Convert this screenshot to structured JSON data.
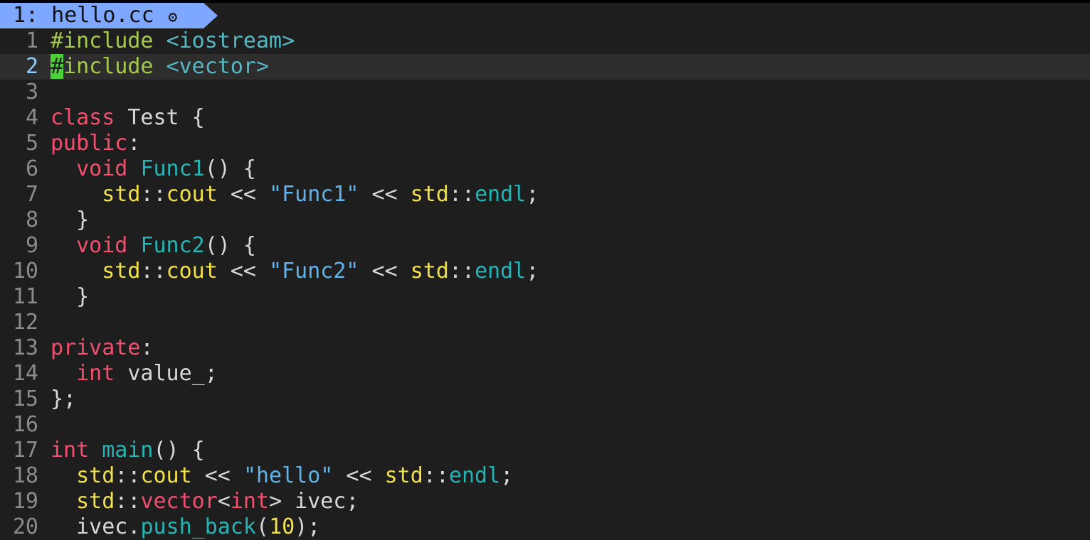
{
  "tab": {
    "label": "1: hello.cc",
    "icon": "cplusplus-icon"
  },
  "current_line": 2,
  "lines": [
    {
      "num": "1",
      "tokens": [
        {
          "c": "pp",
          "t": "#include"
        },
        {
          "c": "pl",
          "t": " "
        },
        {
          "c": "inc",
          "t": "<iostream>"
        }
      ]
    },
    {
      "num": "2",
      "tokens": [
        {
          "c": "cursor",
          "t": "#"
        },
        {
          "c": "pp",
          "t": "include"
        },
        {
          "c": "pl",
          "t": " "
        },
        {
          "c": "inc",
          "t": "<vector>"
        }
      ]
    },
    {
      "num": "3",
      "tokens": []
    },
    {
      "num": "4",
      "tokens": [
        {
          "c": "kw",
          "t": "class"
        },
        {
          "c": "pl",
          "t": " Test {"
        }
      ]
    },
    {
      "num": "5",
      "tokens": [
        {
          "c": "kw",
          "t": "public"
        },
        {
          "c": "pl",
          "t": ":"
        }
      ]
    },
    {
      "num": "6",
      "tokens": [
        {
          "c": "pl",
          "t": "  "
        },
        {
          "c": "ty",
          "t": "void"
        },
        {
          "c": "pl",
          "t": " "
        },
        {
          "c": "fn",
          "t": "Func1"
        },
        {
          "c": "pl",
          "t": "() {"
        }
      ]
    },
    {
      "num": "7",
      "tokens": [
        {
          "c": "pl",
          "t": "    "
        },
        {
          "c": "ns",
          "t": "std"
        },
        {
          "c": "pl",
          "t": "::"
        },
        {
          "c": "ns",
          "t": "cout"
        },
        {
          "c": "pl",
          "t": " << "
        },
        {
          "c": "str",
          "t": "\"Func1\""
        },
        {
          "c": "pl",
          "t": " << "
        },
        {
          "c": "ns",
          "t": "std"
        },
        {
          "c": "pl",
          "t": "::"
        },
        {
          "c": "fn",
          "t": "endl"
        },
        {
          "c": "pl",
          "t": ";"
        }
      ]
    },
    {
      "num": "8",
      "tokens": [
        {
          "c": "pl",
          "t": "  }"
        }
      ]
    },
    {
      "num": "9",
      "tokens": [
        {
          "c": "pl",
          "t": "  "
        },
        {
          "c": "ty",
          "t": "void"
        },
        {
          "c": "pl",
          "t": " "
        },
        {
          "c": "fn",
          "t": "Func2"
        },
        {
          "c": "pl",
          "t": "() {"
        }
      ]
    },
    {
      "num": "10",
      "tokens": [
        {
          "c": "pl",
          "t": "    "
        },
        {
          "c": "ns",
          "t": "std"
        },
        {
          "c": "pl",
          "t": "::"
        },
        {
          "c": "ns",
          "t": "cout"
        },
        {
          "c": "pl",
          "t": " << "
        },
        {
          "c": "str",
          "t": "\"Func2\""
        },
        {
          "c": "pl",
          "t": " << "
        },
        {
          "c": "ns",
          "t": "std"
        },
        {
          "c": "pl",
          "t": "::"
        },
        {
          "c": "fn",
          "t": "endl"
        },
        {
          "c": "pl",
          "t": ";"
        }
      ]
    },
    {
      "num": "11",
      "tokens": [
        {
          "c": "pl",
          "t": "  }"
        }
      ]
    },
    {
      "num": "12",
      "tokens": []
    },
    {
      "num": "13",
      "tokens": [
        {
          "c": "kw",
          "t": "private"
        },
        {
          "c": "pl",
          "t": ":"
        }
      ]
    },
    {
      "num": "14",
      "tokens": [
        {
          "c": "pl",
          "t": "  "
        },
        {
          "c": "ty",
          "t": "int"
        },
        {
          "c": "pl",
          "t": " value_;"
        }
      ]
    },
    {
      "num": "15",
      "tokens": [
        {
          "c": "pl",
          "t": "};"
        }
      ]
    },
    {
      "num": "16",
      "tokens": []
    },
    {
      "num": "17",
      "tokens": [
        {
          "c": "ty",
          "t": "int"
        },
        {
          "c": "pl",
          "t": " "
        },
        {
          "c": "fn",
          "t": "main"
        },
        {
          "c": "pl",
          "t": "() {"
        }
      ]
    },
    {
      "num": "18",
      "tokens": [
        {
          "c": "pl",
          "t": "  "
        },
        {
          "c": "ns",
          "t": "std"
        },
        {
          "c": "pl",
          "t": "::"
        },
        {
          "c": "ns",
          "t": "cout"
        },
        {
          "c": "pl",
          "t": " << "
        },
        {
          "c": "str",
          "t": "\"hello\""
        },
        {
          "c": "pl",
          "t": " << "
        },
        {
          "c": "ns",
          "t": "std"
        },
        {
          "c": "pl",
          "t": "::"
        },
        {
          "c": "fn",
          "t": "endl"
        },
        {
          "c": "pl",
          "t": ";"
        }
      ]
    },
    {
      "num": "19",
      "tokens": [
        {
          "c": "pl",
          "t": "  "
        },
        {
          "c": "ns",
          "t": "std"
        },
        {
          "c": "pl",
          "t": "::"
        },
        {
          "c": "kw",
          "t": "vector"
        },
        {
          "c": "pl",
          "t": "<"
        },
        {
          "c": "ty",
          "t": "int"
        },
        {
          "c": "pl",
          "t": "> ivec;"
        }
      ]
    },
    {
      "num": "20",
      "tokens": [
        {
          "c": "pl",
          "t": "  ivec."
        },
        {
          "c": "fn",
          "t": "push_back"
        },
        {
          "c": "pl",
          "t": "("
        },
        {
          "c": "num",
          "t": "10"
        },
        {
          "c": "pl",
          "t": ");"
        }
      ]
    }
  ]
}
